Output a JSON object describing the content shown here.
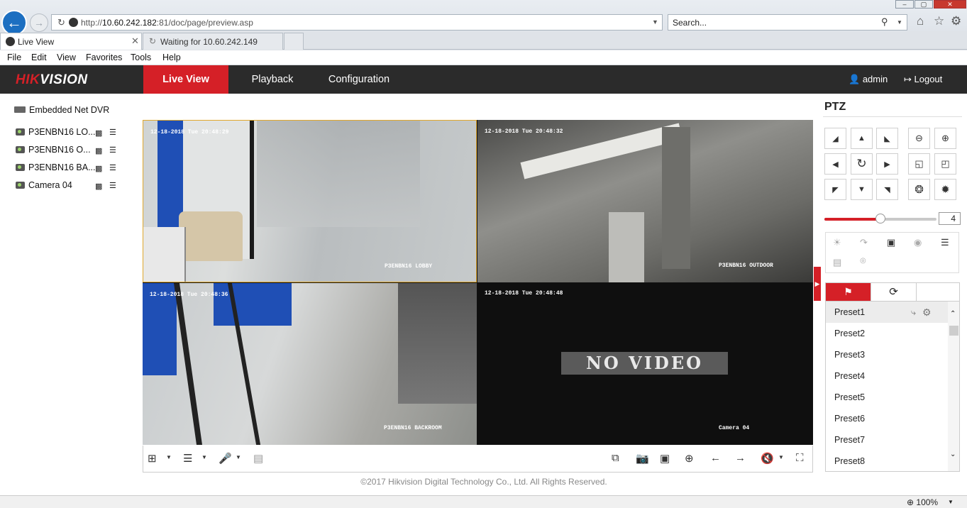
{
  "browser": {
    "url_prefix": "http://",
    "url_host": "10.60.242.182",
    "url_rest": ":81/doc/page/preview.asp",
    "search_placeholder": "Search...",
    "tabs": [
      {
        "label": "Live View"
      },
      {
        "label": "Waiting for 10.60.242.149"
      }
    ],
    "menu": [
      "File",
      "Edit",
      "View",
      "Favorites",
      "Tools",
      "Help"
    ],
    "zoom": "100%"
  },
  "app": {
    "logo_red": "HIK",
    "logo_white": "VISION",
    "nav": [
      "Live View",
      "Playback",
      "Configuration"
    ],
    "user": "admin",
    "logout": "Logout",
    "accent_color": "#d52027"
  },
  "tree": {
    "root": "Embedded Net DVR",
    "channels": [
      "P3ENBN16 LO...",
      "P3ENBN16 O...",
      "P3ENBN16 BA...",
      "Camera 04"
    ]
  },
  "views": [
    {
      "timestamp": "12-18-2018 Tue 20:48:29",
      "name": "P3ENBN16 LOBBY"
    },
    {
      "timestamp": "12-18-2018 Tue 20:48:32",
      "name": "P3ENBN16 OUTDOOR"
    },
    {
      "timestamp": "12-18-2018 Tue 20:48:36",
      "name": "P3ENBN16 BACKROOM"
    },
    {
      "timestamp": "12-18-2018 Tue 20:48:48",
      "name": "Camera 04",
      "no_video": "NO VIDEO"
    }
  ],
  "footer": {
    "copyright": "©2017 Hikvision Digital Technology Co., Ltd. All Rights Reserved."
  },
  "ptz": {
    "title": "PTZ",
    "speed": "4",
    "speed_fraction": 0.5,
    "presets": [
      "Preset1",
      "Preset2",
      "Preset3",
      "Preset4",
      "Preset5",
      "Preset6",
      "Preset7",
      "Preset8"
    ]
  }
}
